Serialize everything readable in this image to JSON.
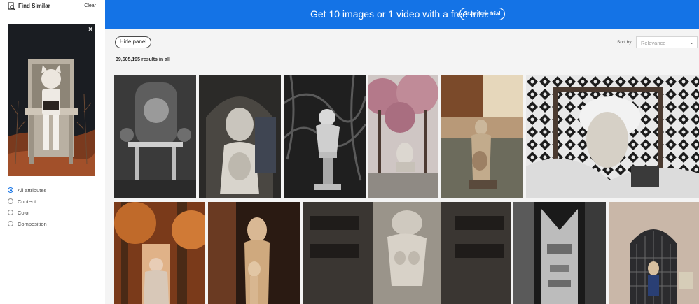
{
  "sidebar": {
    "title": "Find Similar",
    "clear_label": "Clear",
    "close_glyph": "×",
    "attributes": [
      {
        "label": "All attributes",
        "selected": true
      },
      {
        "label": "Content",
        "selected": false
      },
      {
        "label": "Color",
        "selected": false
      },
      {
        "label": "Composition",
        "selected": false
      }
    ]
  },
  "banner": {
    "text": "Get 10 images or 1 video with a free trial.",
    "button_label": "Start free trial",
    "color": "#1473e6"
  },
  "toolbar": {
    "hide_panel_label": "Hide panel",
    "results_text": "39,605,195 results in all",
    "sort_label": "Sort by",
    "sort_value": "Relevance",
    "chevron_glyph": "⌄"
  }
}
